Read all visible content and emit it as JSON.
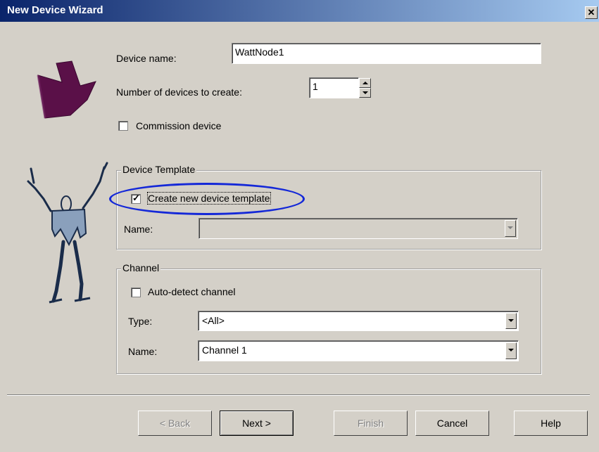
{
  "window": {
    "title": "New Device Wizard"
  },
  "device": {
    "name_label": "Device name:",
    "name_value": "WattNode1",
    "count_label": "Number of devices to create:",
    "count_value": "1",
    "commission_label": "Commission device",
    "commission_checked": false
  },
  "template_group": {
    "legend": "Device Template",
    "create_label": "Create new device template",
    "create_checked": true,
    "name_label": "Name:",
    "name_value": ""
  },
  "channel_group": {
    "legend": "Channel",
    "autodetect_label": "Auto-detect channel",
    "autodetect_checked": false,
    "type_label": "Type:",
    "type_value": "<All>",
    "name_label": "Name:",
    "name_value": "Channel 1"
  },
  "buttons": {
    "back": "< Back",
    "next": "Next >",
    "finish": "Finish",
    "cancel": "Cancel",
    "help": "Help"
  },
  "icons": [
    "close-icon",
    "puzzle-piece-icon",
    "dancer-figure-icon",
    "checkmark-icon",
    "chevron-down-icon",
    "spin-up-icon",
    "spin-down-icon"
  ],
  "colors": {
    "titlebar_start": "#0a246a",
    "titlebar_end": "#a6caf0",
    "dialog_bg": "#d4d0c8",
    "annotation": "#1428d8"
  }
}
